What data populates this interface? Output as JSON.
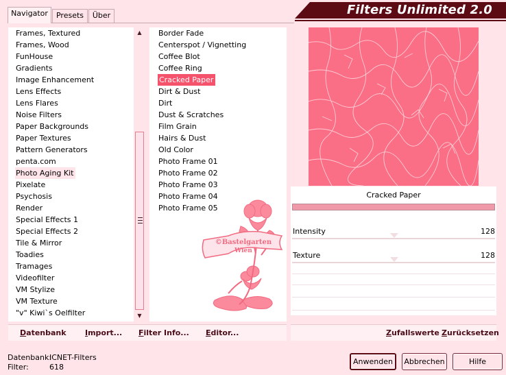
{
  "app": {
    "title": "Filters Unlimited 2.0"
  },
  "tabs": [
    {
      "label": "Navigator",
      "active": true
    },
    {
      "label": "Presets",
      "active": false
    },
    {
      "label": "Über",
      "active": false
    }
  ],
  "categories": {
    "selected": "Photo Aging Kit",
    "items": [
      "Frames, Textured",
      "Frames, Wood",
      "FunHouse",
      "Gradients",
      "Image Enhancement",
      "Lens Effects",
      "Lens Flares",
      "Noise Filters",
      "Paper Backgrounds",
      "Paper Textures",
      "Pattern Generators",
      "penta.com",
      "Photo Aging Kit",
      "Pixelate",
      "Psychosis",
      "Render",
      "Special Effects 1",
      "Special Effects 2",
      "Tile & Mirror",
      "Toadies",
      "Tramages",
      "Videofilter",
      "VM Stylize",
      "VM Texture",
      "\"v\" Kiwi`s Oelfilter"
    ]
  },
  "filters": {
    "selected": "Cracked Paper",
    "items": [
      "Border Fade",
      "Centerspot / Vignetting",
      "Coffee Blot",
      "Coffee Ring",
      "Cracked Paper",
      "Dirt & Dust",
      "Dirt",
      "Dust & Scratches",
      "Film Grain",
      "Hairs & Dust",
      "Old Color",
      "Photo Frame 01",
      "Photo Frame 02",
      "Photo Frame 03",
      "Photo Frame 04",
      "Photo Frame 05"
    ]
  },
  "watermark": {
    "line1": "©Bastelgarten",
    "line2": "Wien"
  },
  "preview": {
    "filter_name": "Cracked Paper"
  },
  "params": [
    {
      "label": "Intensity",
      "value": "128",
      "level": 128,
      "max": 255
    },
    {
      "label": "Texture",
      "value": "128",
      "level": 128,
      "max": 255
    }
  ],
  "bottom_left": {
    "datenbank": "Datenbank",
    "import": "Import...",
    "filter_info": "Filter Info...",
    "editor": "Editor..."
  },
  "bottom_right": {
    "random": "Zufallswerte",
    "reset": "Zurücksetzen"
  },
  "status": {
    "db_label": "Datenbank:",
    "db_value": "ICNET-Filters",
    "filter_label": "Filter:",
    "filter_value": "618"
  },
  "buttons": {
    "apply": "Anwenden",
    "cancel": "Abbrechen",
    "help": "Hilfe"
  },
  "colors": {
    "accent": "#f5526c",
    "banner": "#5c0a14",
    "preview": "#fb6f86",
    "background": "#ffe4ea"
  },
  "icons": {
    "scroll_up": "triangle-up",
    "scroll_down": "triangle-down",
    "grip": "scroll-grip"
  }
}
